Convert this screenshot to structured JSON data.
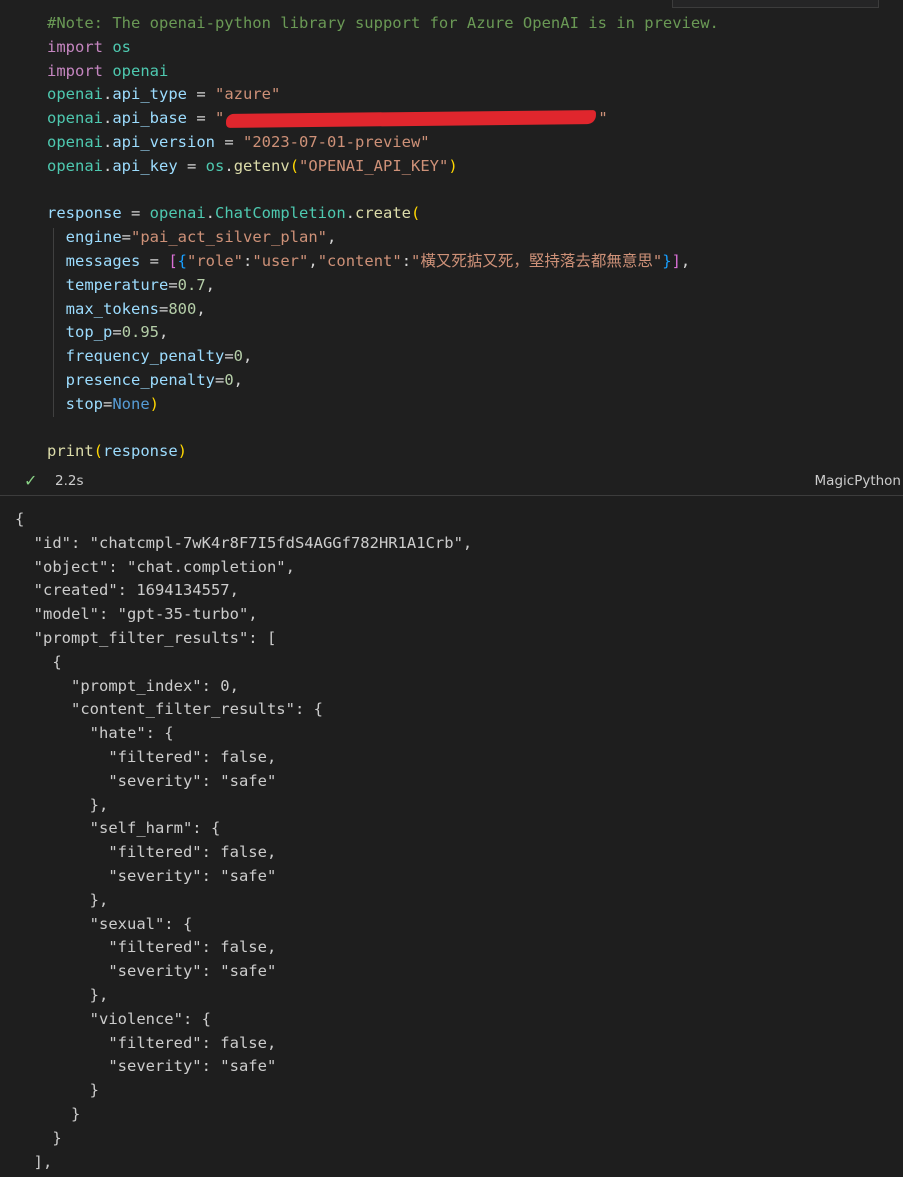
{
  "cell": {
    "code_lines": [
      {
        "indent": "",
        "parts": [
          {
            "t": "#Note: The openai-python library support for Azure OpenAI is in preview.",
            "c": "cm"
          }
        ]
      },
      {
        "indent": "",
        "parts": [
          {
            "t": "import",
            "c": "kw"
          },
          {
            "t": " ",
            "c": "op"
          },
          {
            "t": "os",
            "c": "mod"
          }
        ]
      },
      {
        "indent": "",
        "parts": [
          {
            "t": "import",
            "c": "kw"
          },
          {
            "t": " ",
            "c": "op"
          },
          {
            "t": "openai",
            "c": "mod"
          }
        ]
      },
      {
        "indent": "",
        "parts": [
          {
            "t": "openai",
            "c": "mod"
          },
          {
            "t": ".",
            "c": "op"
          },
          {
            "t": "api_type",
            "c": "var"
          },
          {
            "t": " = ",
            "c": "op"
          },
          {
            "t": "\"azure\"",
            "c": "str"
          }
        ]
      },
      {
        "indent": "",
        "parts": [
          {
            "t": "openai",
            "c": "mod"
          },
          {
            "t": ".",
            "c": "op"
          },
          {
            "t": "api_base",
            "c": "var"
          },
          {
            "t": " = ",
            "c": "op"
          },
          {
            "t": "\"",
            "c": "str"
          },
          {
            "t": "",
            "c": "redact"
          },
          {
            "t": "\"",
            "c": "str"
          }
        ]
      },
      {
        "indent": "",
        "parts": [
          {
            "t": "openai",
            "c": "mod"
          },
          {
            "t": ".",
            "c": "op"
          },
          {
            "t": "api_version",
            "c": "var"
          },
          {
            "t": " = ",
            "c": "op"
          },
          {
            "t": "\"2023-07-01-preview\"",
            "c": "str"
          }
        ]
      },
      {
        "indent": "",
        "parts": [
          {
            "t": "openai",
            "c": "mod"
          },
          {
            "t": ".",
            "c": "op"
          },
          {
            "t": "api_key",
            "c": "var"
          },
          {
            "t": " = ",
            "c": "op"
          },
          {
            "t": "os",
            "c": "mod"
          },
          {
            "t": ".",
            "c": "op"
          },
          {
            "t": "getenv",
            "c": "fn"
          },
          {
            "t": "(",
            "c": "br1"
          },
          {
            "t": "\"OPENAI_API_KEY\"",
            "c": "str"
          },
          {
            "t": ")",
            "c": "br1"
          }
        ]
      },
      {
        "indent": "",
        "parts": []
      },
      {
        "indent": "",
        "parts": [
          {
            "t": "response",
            "c": "var"
          },
          {
            "t": " = ",
            "c": "op"
          },
          {
            "t": "openai",
            "c": "mod"
          },
          {
            "t": ".",
            "c": "op"
          },
          {
            "t": "ChatCompletion",
            "c": "cls"
          },
          {
            "t": ".",
            "c": "op"
          },
          {
            "t": "create",
            "c": "fn"
          },
          {
            "t": "(",
            "c": "br1"
          }
        ]
      },
      {
        "indent": "  ",
        "parts": [
          {
            "t": "engine",
            "c": "var"
          },
          {
            "t": "=",
            "c": "op"
          },
          {
            "t": "\"pai_act_silver_plan\"",
            "c": "str"
          },
          {
            "t": ",",
            "c": "op"
          }
        ]
      },
      {
        "indent": "  ",
        "parts": [
          {
            "t": "messages",
            "c": "var"
          },
          {
            "t": " = ",
            "c": "op"
          },
          {
            "t": "[",
            "c": "br2"
          },
          {
            "t": "{",
            "c": "br3"
          },
          {
            "t": "\"role\"",
            "c": "str"
          },
          {
            "t": ":",
            "c": "op"
          },
          {
            "t": "\"user\"",
            "c": "str"
          },
          {
            "t": ",",
            "c": "op"
          },
          {
            "t": "\"content\"",
            "c": "str"
          },
          {
            "t": ":",
            "c": "op"
          },
          {
            "t": "\"橫又死掂又死，堅持落去都無意思\"",
            "c": "str"
          },
          {
            "t": "}",
            "c": "br3"
          },
          {
            "t": "]",
            "c": "br2"
          },
          {
            "t": ",",
            "c": "op"
          }
        ]
      },
      {
        "indent": "  ",
        "parts": [
          {
            "t": "temperature",
            "c": "var"
          },
          {
            "t": "=",
            "c": "op"
          },
          {
            "t": "0.7",
            "c": "num"
          },
          {
            "t": ",",
            "c": "op"
          }
        ]
      },
      {
        "indent": "  ",
        "parts": [
          {
            "t": "max_tokens",
            "c": "var"
          },
          {
            "t": "=",
            "c": "op"
          },
          {
            "t": "800",
            "c": "num"
          },
          {
            "t": ",",
            "c": "op"
          }
        ]
      },
      {
        "indent": "  ",
        "parts": [
          {
            "t": "top_p",
            "c": "var"
          },
          {
            "t": "=",
            "c": "op"
          },
          {
            "t": "0.95",
            "c": "num"
          },
          {
            "t": ",",
            "c": "op"
          }
        ]
      },
      {
        "indent": "  ",
        "parts": [
          {
            "t": "frequency_penalty",
            "c": "var"
          },
          {
            "t": "=",
            "c": "op"
          },
          {
            "t": "0",
            "c": "num"
          },
          {
            "t": ",",
            "c": "op"
          }
        ]
      },
      {
        "indent": "  ",
        "parts": [
          {
            "t": "presence_penalty",
            "c": "var"
          },
          {
            "t": "=",
            "c": "op"
          },
          {
            "t": "0",
            "c": "num"
          },
          {
            "t": ",",
            "c": "op"
          }
        ]
      },
      {
        "indent": "  ",
        "parts": [
          {
            "t": "stop",
            "c": "var"
          },
          {
            "t": "=",
            "c": "op"
          },
          {
            "t": "None",
            "c": "const"
          },
          {
            "t": ")",
            "c": "br1"
          }
        ]
      },
      {
        "indent": "",
        "parts": []
      },
      {
        "indent": "",
        "parts": [
          {
            "t": "print",
            "c": "fn"
          },
          {
            "t": "(",
            "c": "br1"
          },
          {
            "t": "response",
            "c": "var"
          },
          {
            "t": ")",
            "c": "br1"
          }
        ]
      }
    ],
    "status": {
      "check_icon": "check-icon",
      "success_color": "#89d185",
      "duration": "2.2s",
      "language": "MagicPython"
    }
  },
  "output": {
    "lines": [
      "{",
      "  \"id\": \"chatcmpl-7wK4r8F7I5fdS4AGGf782HR1A1Crb\",",
      "  \"object\": \"chat.completion\",",
      "  \"created\": 1694134557,",
      "  \"model\": \"gpt-35-turbo\",",
      "  \"prompt_filter_results\": [",
      "    {",
      "      \"prompt_index\": 0,",
      "      \"content_filter_results\": {",
      "        \"hate\": {",
      "          \"filtered\": false,",
      "          \"severity\": \"safe\"",
      "        },",
      "        \"self_harm\": {",
      "          \"filtered\": false,",
      "          \"severity\": \"safe\"",
      "        },",
      "        \"sexual\": {",
      "          \"filtered\": false,",
      "          \"severity\": \"safe\"",
      "        },",
      "        \"violence\": {",
      "          \"filtered\": false,",
      "          \"severity\": \"safe\"",
      "        }",
      "      }",
      "    }",
      "  ],"
    ]
  }
}
